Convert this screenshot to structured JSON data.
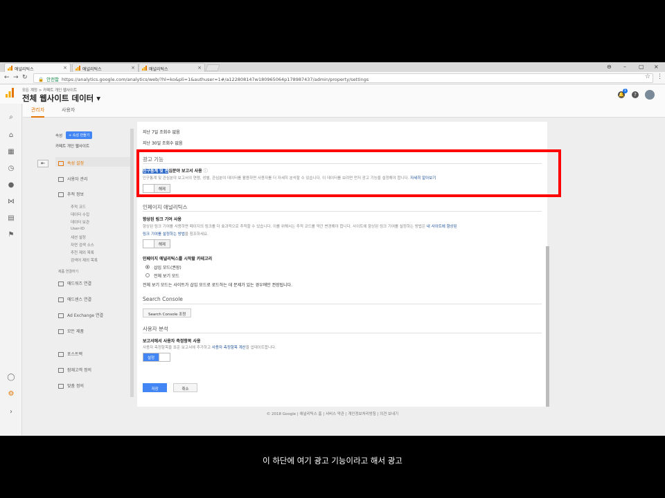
{
  "browser": {
    "tabs": [
      {
        "label": "애널리틱스"
      },
      {
        "label": "애널리틱스"
      },
      {
        "label": "애널리틱스"
      }
    ],
    "secure_label": "안전함",
    "url": "https://analytics.google.com/analytics/web/?hl=ko&pli=1&authuser=1#/a122808147w180965064p178987437/admin/property/settings"
  },
  "header": {
    "breadcrumb": "모든 계정 > 카페트 개인 웹사이트",
    "title": "전체 웹사이트 데이터 ▾",
    "notif_count": "1",
    "help_label": "?"
  },
  "admin_tabs": {
    "admin": "관리자",
    "user": "사용자"
  },
  "property": {
    "label": "속성",
    "create_button": "+ 속성 만들기",
    "name": "카페트 개인 웹사이트",
    "back": "⇤",
    "menu": [
      {
        "label": "속성 설정"
      },
      {
        "label": "사용자 관리"
      },
      {
        "label": "추적 정보"
      }
    ],
    "tracking_sub": [
      "추적 코드",
      "데이터 수집",
      "데이터 보관",
      "User-ID",
      "세션 설정",
      "자연 검색 소스",
      "추천 제외 목록",
      "검색어 제외 목록"
    ],
    "product_linking_label": "제품 연결하기",
    "products": [
      {
        "label": "애드워즈 연결"
      },
      {
        "label": "애드센스 연결"
      },
      {
        "label": "Ad Exchange 연결"
      },
      {
        "label": "모든 제품"
      },
      {
        "label": "포스트백"
      },
      {
        "label": "잠재고객 정의"
      },
      {
        "label": "맞춤 정의"
      }
    ]
  },
  "settings": {
    "last7": "지난 7일  조회수 없음",
    "last30": "지난 30일  조회수 없음",
    "ad_features_title": "광고 기능",
    "ad_features_label_hl": "인구통계 및 관",
    "ad_features_label_rest": "심분야 보고서 사용",
    "ad_features_desc": "인구통계 및 관심분야 보고서의 연령, 성별, 관심분야 데이터를 활용하면 사용자를 더 자세히 분석할 수 있습니다. 이 데이터를 보려면 먼저 광고 기능을 설정해야 합니다.",
    "ad_features_more": "자세히 알아보기",
    "toggle_off": "해제",
    "toggle_on": "설정",
    "inpage_title": "인페이지 애널리틱스",
    "enhanced_label": "향상된 링크 기여 사용",
    "enhanced_desc1": "향상된 링크 기여를 사용하면 페이지의 링크를 더 효과적으로 추적할 수 있습니다. 이를 위해서는 추적 코드를 약간 변경해야 합니다. 사이트에 향상된 링크 기여를 설정하는 방법은",
    "enhanced_link": "내 사이트에 향상된",
    "enhanced_desc2_link": "링크 기여를 설정하는 방법",
    "enhanced_desc2_rest": "을 참조하세요.",
    "inpage_start_label": "인페이지 애널리틱스를 시작할 카테고리",
    "radio1": "삽입 모드(권장)",
    "radio2": "전체 보기 모드",
    "fullview_note": "전체 보기 모드는 사이트가 삽입 모드로 로드하는 데 문제가 있는 경우에만 권장됩니다.",
    "search_console_title": "Search Console",
    "search_console_button": "Search Console 조정",
    "user_analysis_title": "사용자 분석",
    "user_metric_label": "보고서에서 사용자 측정항목 사용",
    "user_metric_desc1": "사용자 측정항목을 표준 보고서에 추가하고",
    "user_metric_link": "사용자 측정항목 계산",
    "user_metric_desc2": "을 업데이트합니다.",
    "save": "저장",
    "cancel": "취소"
  },
  "footer": "© 2018 Google | 애널리틱스 홈 | 서비스 약관 | 개인정보처리방침 | 의견 보내기",
  "caption": "이 하단에 여기 광고 기능이라고 해서 광고",
  "colors": {
    "accent": "#e37400",
    "primary": "#4285f4",
    "annotation": "#ff0000"
  }
}
